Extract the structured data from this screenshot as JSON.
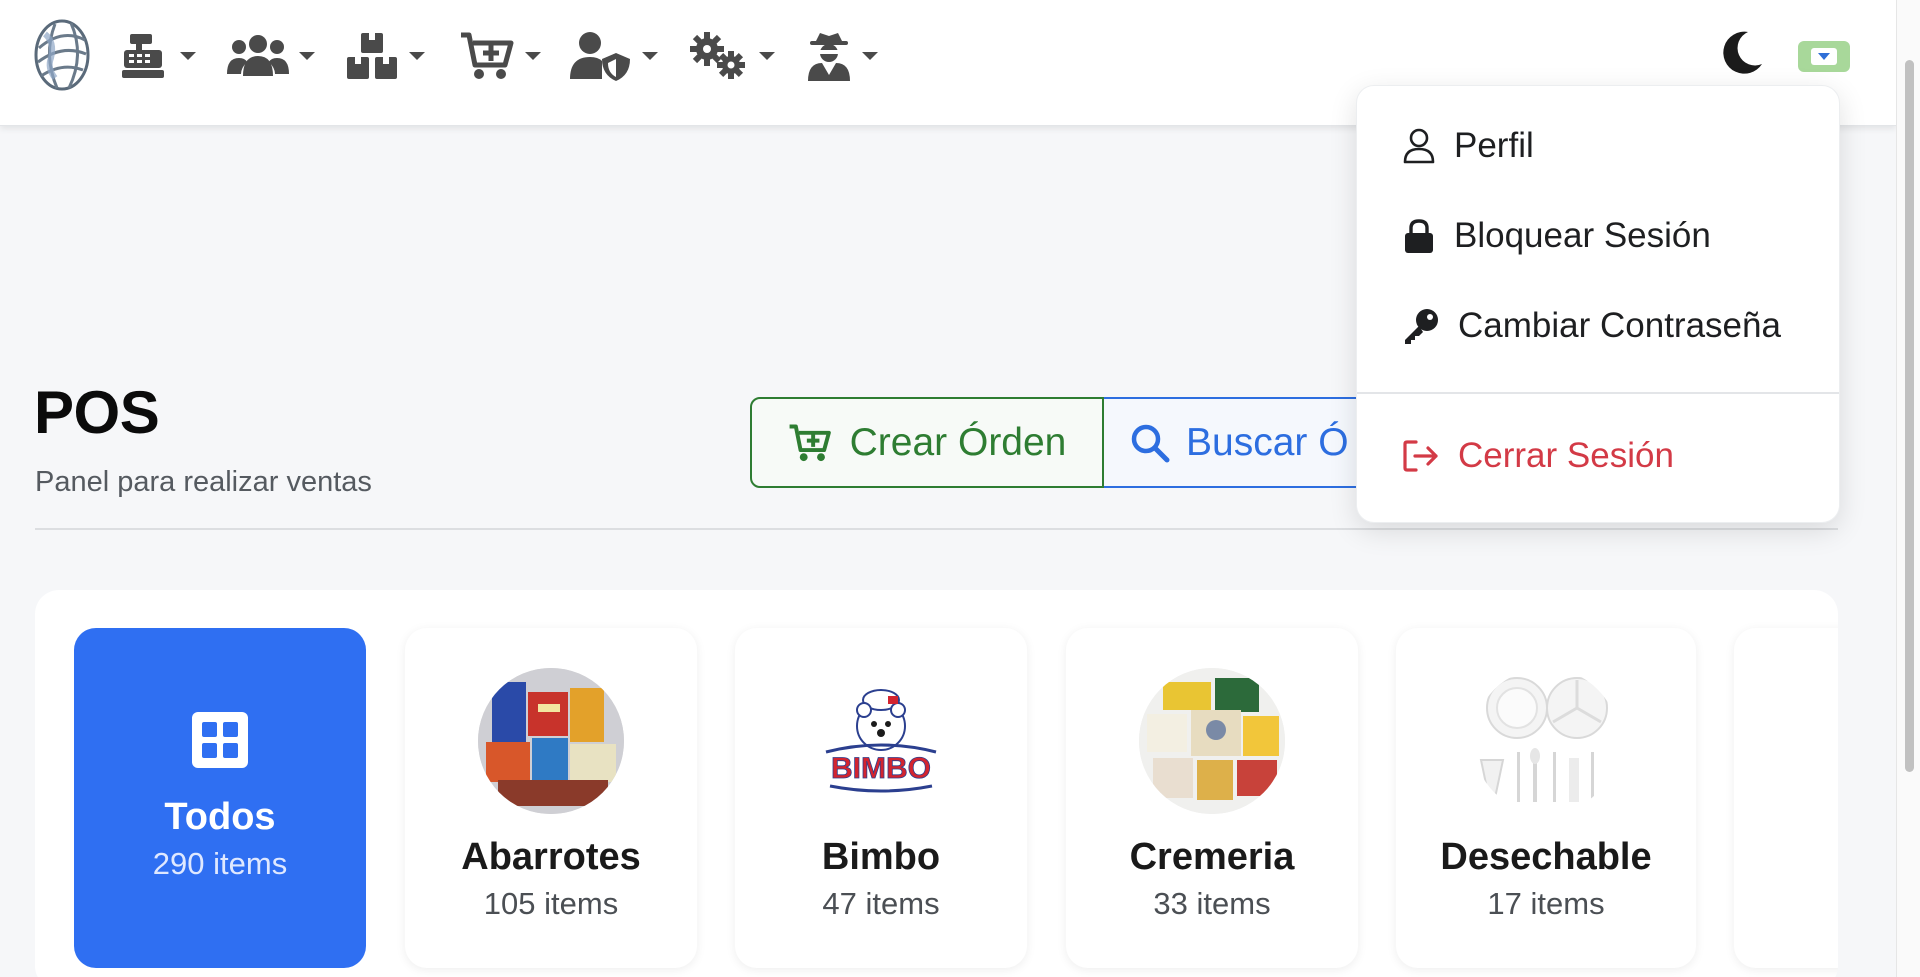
{
  "navbar": {
    "logo_icon": "globe-logo-icon",
    "menus": [
      {
        "name": "cash-register",
        "icon": "cash-register-icon"
      },
      {
        "name": "users",
        "icon": "users-icon"
      },
      {
        "name": "boxes",
        "icon": "boxes-icon"
      },
      {
        "name": "cart-plus",
        "icon": "cart-plus-icon"
      },
      {
        "name": "user-shield",
        "icon": "user-shield-icon"
      },
      {
        "name": "cogs",
        "icon": "cogs-icon"
      },
      {
        "name": "user-secret",
        "icon": "user-secret-icon"
      }
    ],
    "theme_icon": "moon-icon",
    "user_toggle_color": "#a8d89a"
  },
  "header": {
    "title": "POS",
    "subtitle": "Panel para realizar ventas",
    "create_label": "Crear Órden",
    "search_label": "Buscar Ó"
  },
  "user_menu": {
    "items": [
      {
        "label": "Perfil",
        "icon": "user-icon"
      },
      {
        "label": "Bloquear Sesión",
        "icon": "lock-icon"
      },
      {
        "label": "Cambiar Contraseña",
        "icon": "key-icon"
      }
    ],
    "logout_label": "Cerrar Sesión",
    "logout_icon": "sign-out-icon",
    "logout_color": "#d33a46"
  },
  "categories": [
    {
      "name": "Todos",
      "count": "290 items",
      "active": true,
      "icon": "grid-icon"
    },
    {
      "name": "Abarrotes",
      "count": "105 items"
    },
    {
      "name": "Bimbo",
      "count": "47 items",
      "logo_text": "BIMBO"
    },
    {
      "name": "Cremeria",
      "count": "33 items"
    },
    {
      "name": "Desechable",
      "count": "17 items"
    }
  ],
  "colors": {
    "primary": "#2f6ff2",
    "success": "#2e7d32",
    "link": "#2d6ee0"
  }
}
